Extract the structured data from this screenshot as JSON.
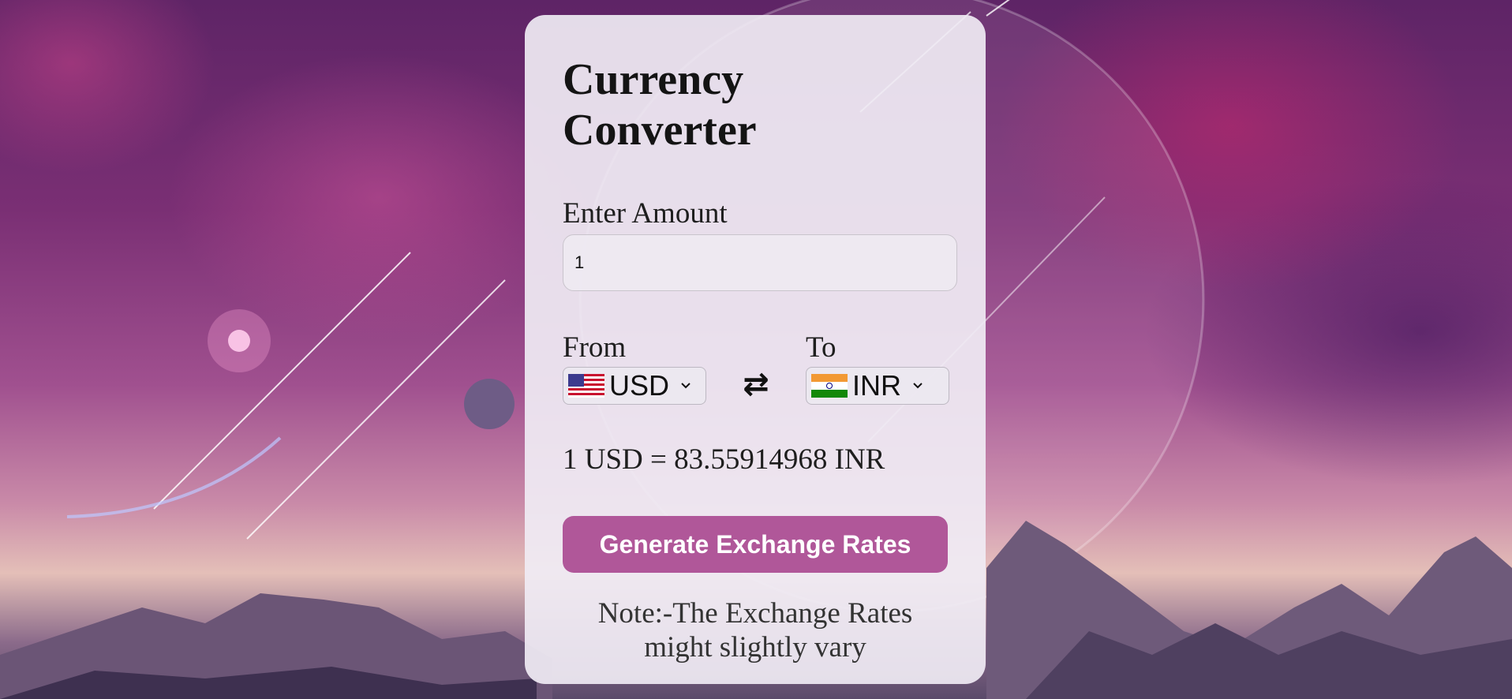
{
  "app": {
    "title": "Currency Converter"
  },
  "amount": {
    "label": "Enter Amount",
    "value": "1"
  },
  "from": {
    "label": "From",
    "currency": "USD",
    "flag_icon": "us-flag-icon"
  },
  "to": {
    "label": "To",
    "currency": "INR",
    "flag_icon": "india-flag-icon"
  },
  "swap_icon": "swap-arrows-icon",
  "result": {
    "text": "1 USD = 83.55914968 INR"
  },
  "actions": {
    "generate_label": "Generate Exchange Rates"
  },
  "note": {
    "text": "Note:-The Exchange Rates might slightly vary"
  },
  "colors": {
    "accent": "#b05799",
    "card_bg": "#f0ecf4",
    "text": "#1e1e1e"
  }
}
